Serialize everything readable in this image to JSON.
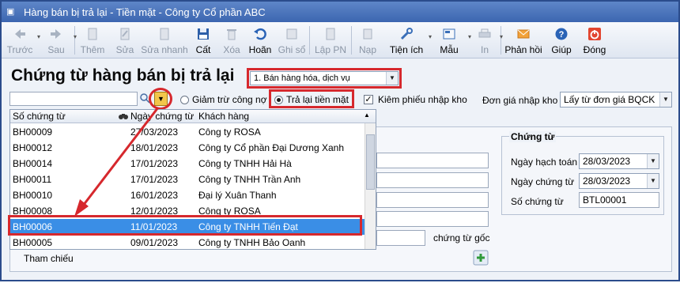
{
  "window": {
    "title": "Hàng bán bị trả lại - Tiền mặt - Công ty Cổ phần ABC"
  },
  "toolbar": {
    "prev": "Trước",
    "next": "Sau",
    "add": "Thêm",
    "edit": "Sửa",
    "quick_edit": "Sửa nhanh",
    "save": "Cất",
    "delete": "Xóa",
    "undo": "Hoãn",
    "post": "Ghi sổ",
    "create_pn": "Lập PN",
    "load": "Nạp",
    "utilities": "Tiện ích",
    "template": "Mẫu",
    "print": "In",
    "feedback": "Phản hồi",
    "help": "Giúp",
    "close": "Đóng"
  },
  "form": {
    "heading": "Chứng từ hàng bán bị trả lại",
    "type_select": "1. Bán hàng hóa, dịch vụ",
    "search_value": "",
    "radio_reduce_debt": "Giảm trừ công nợ",
    "radio_cash_refund": "Trả lại tiền mặt",
    "check_warehouse": "Kiêm phiếu nhập kho",
    "import_price_label": "Đơn giá nhập kho",
    "import_price_value": "Lấy từ đơn giá BQCK",
    "attached_doc_label": "chứng từ gốc",
    "reference_label": "Tham chiếu"
  },
  "voucher": {
    "group_title": "Chứng từ",
    "accounting_date_label": "Ngày hạch toán",
    "accounting_date": "28/03/2023",
    "voucher_date_label": "Ngày chứng từ",
    "voucher_date": "28/03/2023",
    "voucher_no_label": "Số chứng từ",
    "voucher_no": "BTL00001"
  },
  "grid": {
    "columns": [
      "Số chứng từ",
      "Ngày chứng từ",
      "Khách hàng"
    ],
    "rows": [
      [
        "BH00009",
        "27/03/2023",
        "Công ty ROSA"
      ],
      [
        "BH00012",
        "18/01/2023",
        "Công ty Cổ phần Đại Dương Xanh"
      ],
      [
        "BH00014",
        "17/01/2023",
        "Công ty TNHH Hải Hà"
      ],
      [
        "BH00011",
        "17/01/2023",
        "Công ty TNHH Trần Anh"
      ],
      [
        "BH00010",
        "16/01/2023",
        "Đại lý Xuân Thanh"
      ],
      [
        "BH00008",
        "12/01/2023",
        "Công ty ROSA"
      ],
      [
        "BH00006",
        "11/01/2023",
        "Công ty TNHH Tiến Đạt"
      ],
      [
        "BH00005",
        "09/01/2023",
        "Công ty TNHH Bảo Oanh"
      ]
    ],
    "selected_index": 6
  },
  "colors": {
    "highlight": "#d6282d",
    "selection": "#3a8ee6",
    "title_bar": "#3c66b0"
  }
}
